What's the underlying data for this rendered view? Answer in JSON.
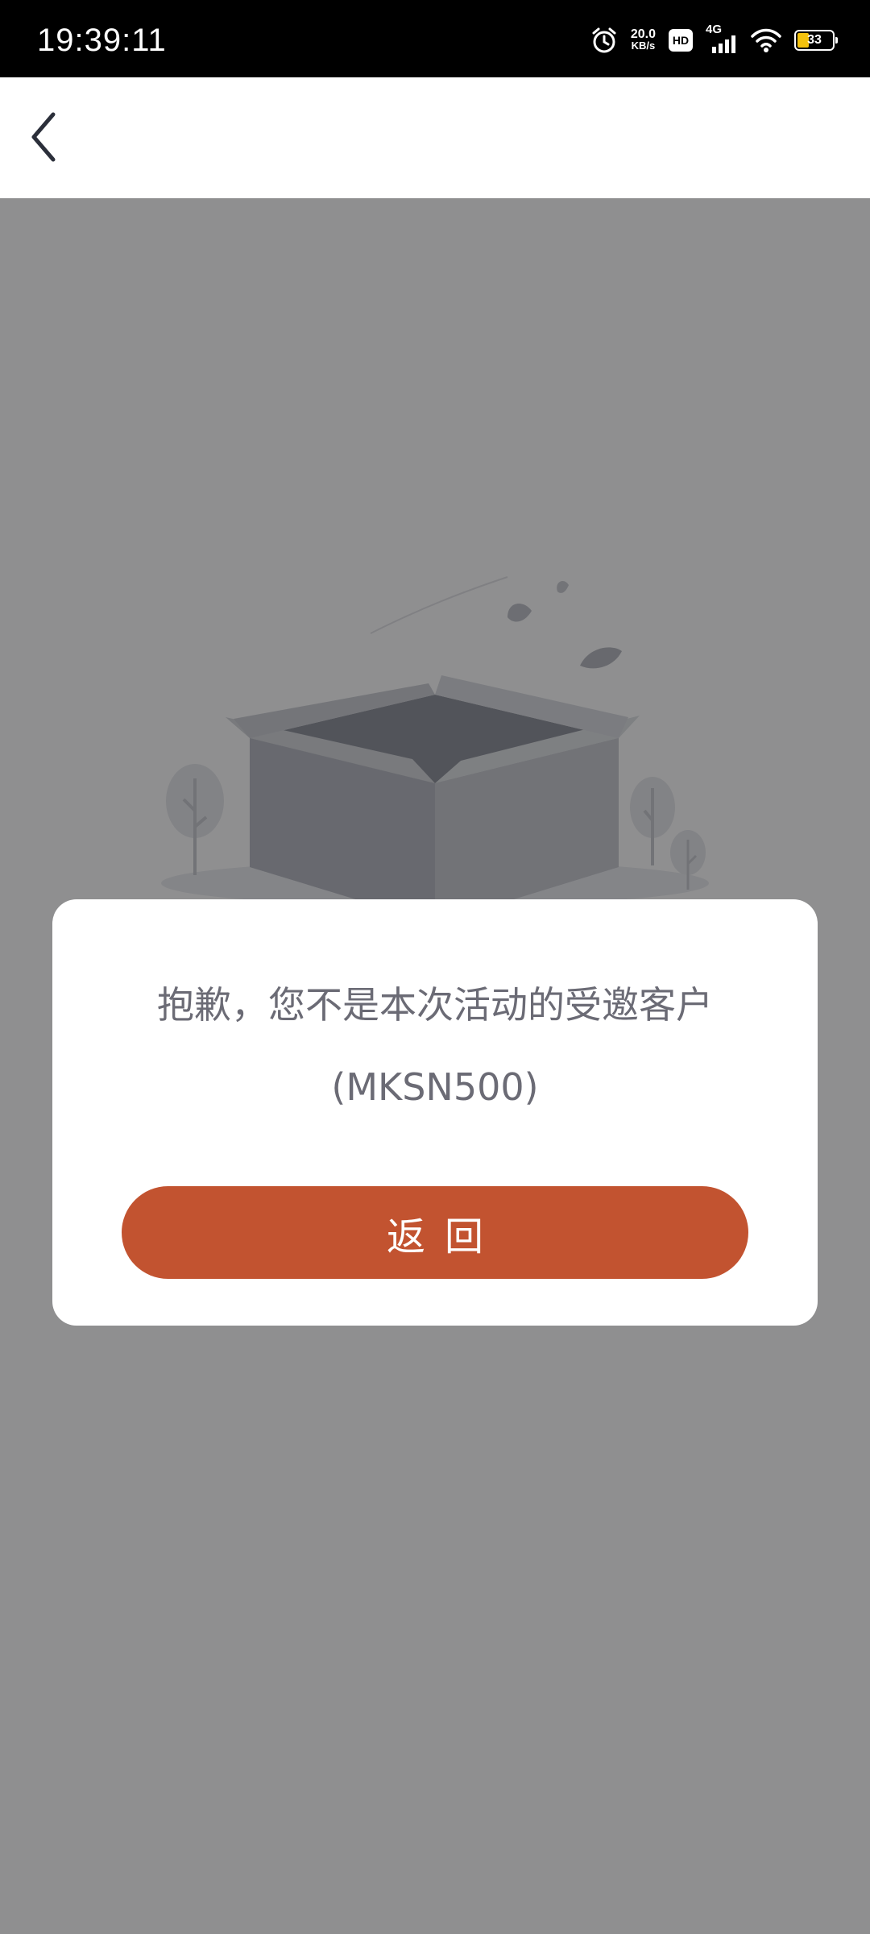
{
  "status_bar": {
    "time": "19:39:11",
    "net_speed_value": "20.0",
    "net_speed_unit": "KB/s",
    "hd_label": "HD",
    "network_type": "4G",
    "battery_level": "33",
    "icons": [
      "alarm-icon",
      "hd-icon",
      "signal-icon",
      "wifi-icon",
      "battery-icon"
    ]
  },
  "nav_bar": {
    "back_icon": "chevron-left-icon"
  },
  "illustration": {
    "name": "empty-box-illustration"
  },
  "dialog": {
    "message": "抱歉，您不是本次活动的受邀客户",
    "code": "(MKSN500)",
    "button_label": "返回"
  },
  "colors": {
    "accent": "#c25330",
    "status_bar_bg": "#000000",
    "overlay": "rgba(0,0,0,0.42)",
    "message_text": "#6b6b75"
  }
}
